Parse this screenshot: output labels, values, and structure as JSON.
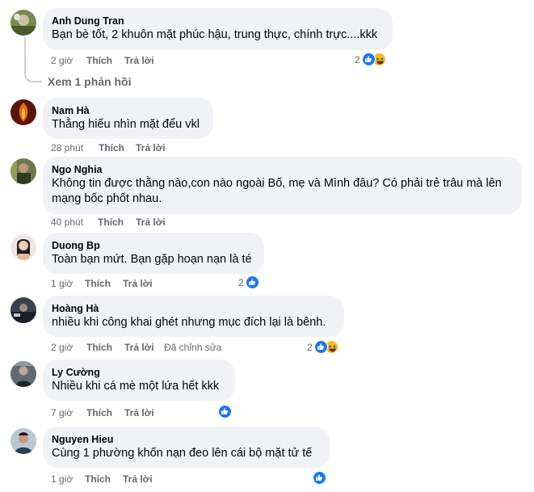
{
  "reply_link": "Xem 1 phản hồi",
  "comments": [
    {
      "author": "Anh Dung Tran",
      "text": "Bạn bè tốt, 2 khuôn mặt phúc hậu, trung thực, chính trực....kkk",
      "time": "2 giờ",
      "like": "Thích",
      "reply": "Trả lời",
      "reaction_count": "2",
      "reactions": [
        "like-icon",
        "haha-icon"
      ]
    },
    {
      "author": "Nam Hà",
      "text": "Thằng hiếu nhìn mặt đểu vkl",
      "time": "28 phút",
      "like": "Thích",
      "reply": "Trả lời"
    },
    {
      "author": "Ngo Nghia",
      "text": "Không tin được thằng nào,con nào ngoài Bố, mẹ và Mình đâu? Có phải trẻ trâu mà lên mạng bốc phốt nhau.",
      "text_line1": "Không tin được thằng nào,con nào ngoài Bố, mẹ và Mình đâu? Có phải trẻ trâu mà lên",
      "text_line2": "mạng bốc phốt nhau.",
      "time": "40 phút",
      "like": "Thích",
      "reply": "Trả lời"
    },
    {
      "author": "Duong Bp",
      "text": "Toàn bạn mứt. Bạn gặp hoạn nạn là té",
      "time": "1 giờ",
      "like": "Thích",
      "reply": "Trả lời",
      "reaction_count": "2",
      "reactions": [
        "like-icon"
      ]
    },
    {
      "author": "Hoàng Hà",
      "text": "nhiều khi công khai ghét nhưng mục đích lại là bênh.",
      "time": "2 giờ",
      "like": "Thích",
      "reply": "Trả lời",
      "edited": "Đã chỉnh sửa",
      "reaction_count": "2",
      "reactions": [
        "like-icon",
        "haha-icon"
      ]
    },
    {
      "author": "Ly Cường",
      "text": "Nhiều khi cá mè một lứa hết kkk",
      "time": "7 giờ",
      "like": "Thích",
      "reply": "Trả lời",
      "reactions": [
        "like-icon"
      ]
    },
    {
      "author": "Nguyen Hieu",
      "text": "Cùng 1 phường khốn nạn đeo lên cái bộ mặt tử tế",
      "time": "1 giờ",
      "like": "Thích",
      "reply": "Trả lời",
      "reactions": [
        "like-icon"
      ]
    }
  ],
  "colors": {
    "like_blue": "#1877f2",
    "haha_yellow": "#f7b928",
    "bubble_bg": "#f0f2f5",
    "meta_gray": "#65676b"
  }
}
